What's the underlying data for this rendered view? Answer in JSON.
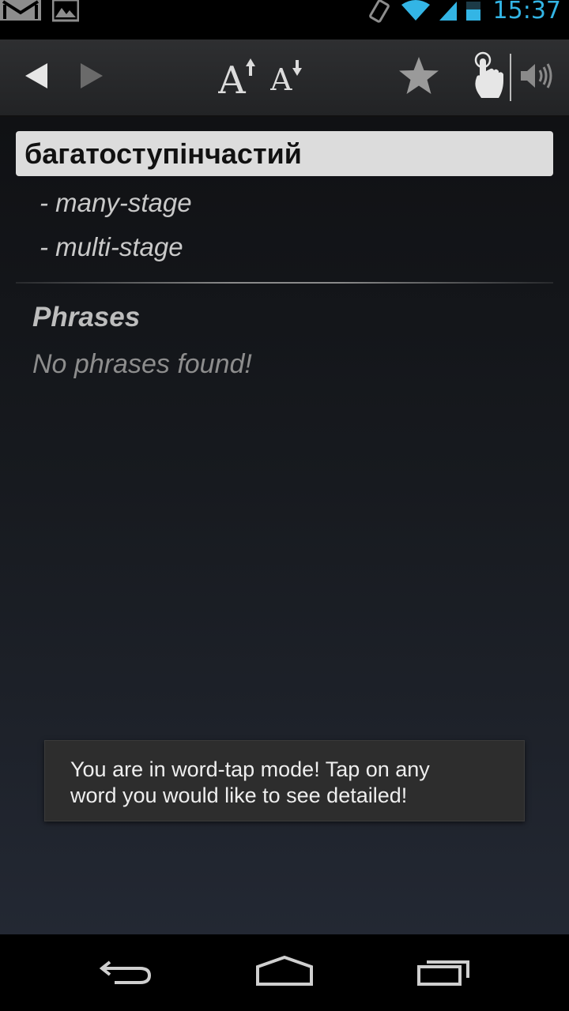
{
  "status_bar": {
    "time": "15:37",
    "left_icons": [
      "gmail-icon",
      "gallery-icon"
    ],
    "right_icons": [
      "vibrate-icon",
      "wifi-icon",
      "signal-icon",
      "battery-icon"
    ]
  },
  "toolbar": {
    "buttons": [
      "back-arrow-icon",
      "forward-arrow-icon",
      "font-increase-icon",
      "font-decrease-icon",
      "favorite-star-icon",
      "word-tap-hand-icon",
      "speaker-icon"
    ]
  },
  "entry": {
    "headword": "багатоступінчастий",
    "translations": [
      "- many-stage",
      "- multi-stage"
    ]
  },
  "phrases": {
    "title": "Phrases",
    "empty_text": "No phrases found!"
  },
  "toast": {
    "line1": "You are in word-tap mode! Tap on any",
    "line2": "word you would like to see detailed!"
  },
  "colors": {
    "clock": "#33b5e5",
    "headword_bg": "#dcdcdc",
    "toast_bg": "#2d2d2d"
  }
}
